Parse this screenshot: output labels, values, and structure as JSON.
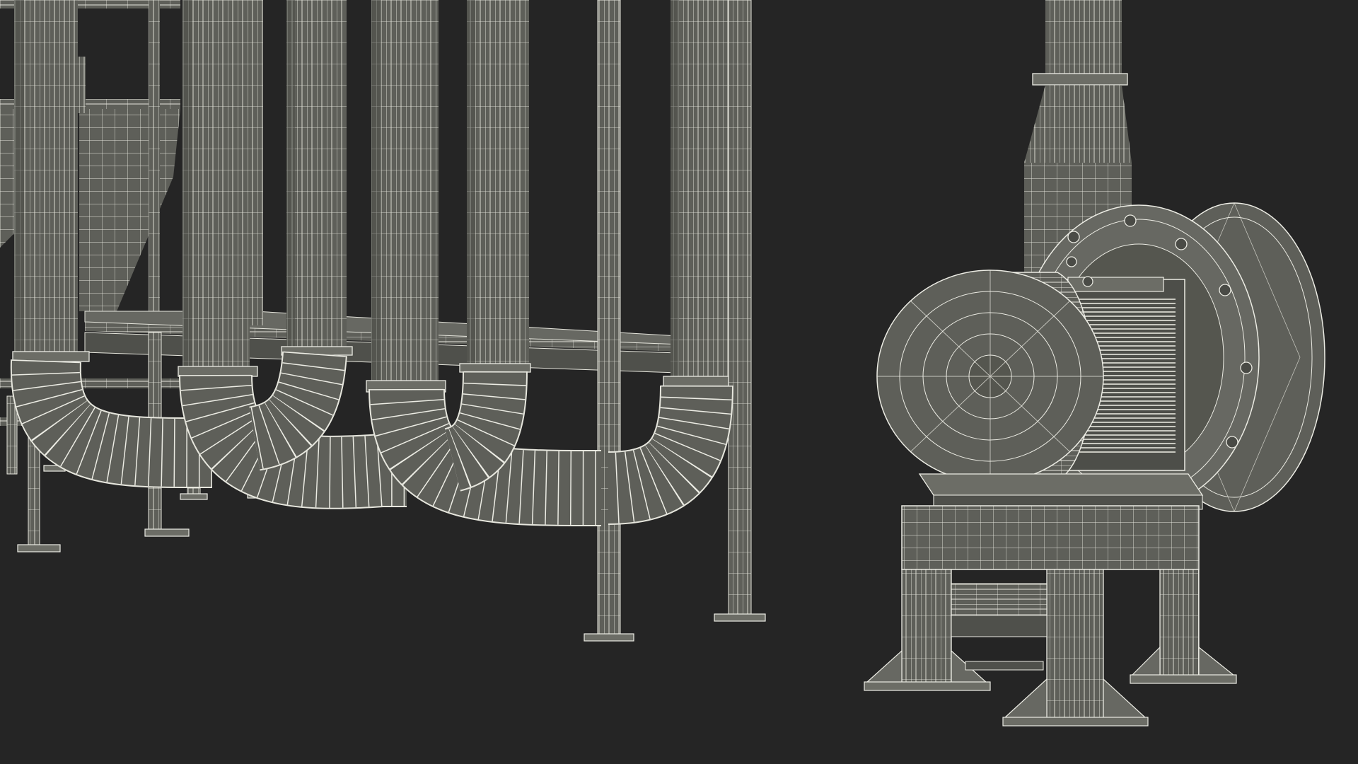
{
  "scene": {
    "background": "#252525",
    "surface_fill": "#5e5f59",
    "surface_light": "#6c6d66",
    "surface_dark": "#4a4b46",
    "wire_color": "#ecece4",
    "rod_color": "#8a8b84"
  }
}
